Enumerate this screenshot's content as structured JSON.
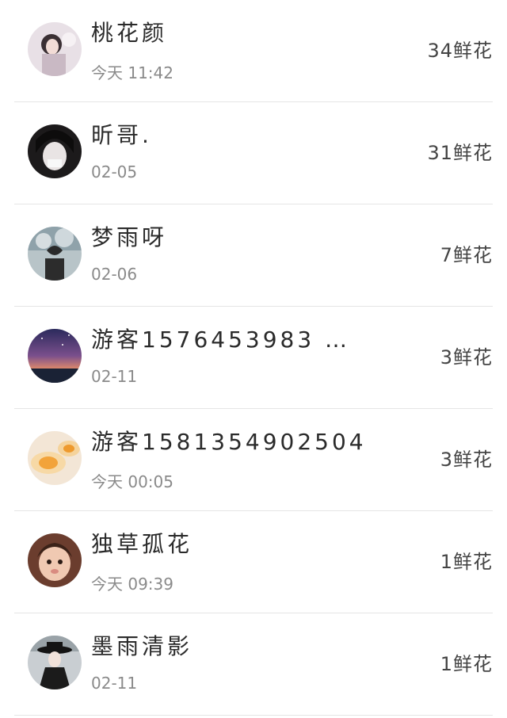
{
  "rows": [
    {
      "name": "桃花颜",
      "time": "今天 11:42",
      "flowers": "34鲜花",
      "avatar": "girl-portrait"
    },
    {
      "name": "昕哥.",
      "time": "02-05",
      "flowers": "31鲜花",
      "avatar": "girl-dark-hair"
    },
    {
      "name": "梦雨呀",
      "time": "02-06",
      "flowers": "7鲜花",
      "avatar": "heart-hands-sky"
    },
    {
      "name": "游客1576453983 …",
      "time": "02-11",
      "flowers": "3鲜花",
      "avatar": "starry-sunset"
    },
    {
      "name": "游客1581354902504",
      "time": "今天 00:05",
      "flowers": "3鲜花",
      "avatar": "egg-tart"
    },
    {
      "name": "独草孤花",
      "time": "今天 09:39",
      "flowers": "1鲜花",
      "avatar": "baby-face"
    },
    {
      "name": "墨雨清影",
      "time": "02-11",
      "flowers": "1鲜花",
      "avatar": "hat-figure"
    }
  ]
}
